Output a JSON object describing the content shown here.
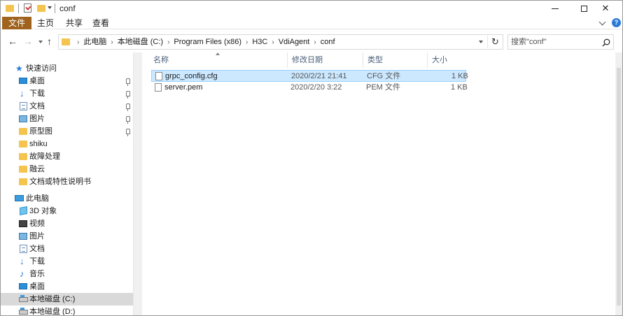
{
  "window": {
    "title": "conf",
    "controls": {
      "minimize": "",
      "maximize": "",
      "close": "✕"
    }
  },
  "ribbon": {
    "tabs": [
      "文件",
      "主页",
      "共享",
      "查看"
    ],
    "help": "?"
  },
  "nav": {
    "back": "←",
    "forward": "→",
    "up": "↑",
    "refresh": "↻",
    "breadcrumb": [
      "此电脑",
      "本地磁盘 (C:)",
      "Program Files (x86)",
      "H3C",
      "VdiAgent",
      "conf"
    ]
  },
  "search": {
    "placeholder": "搜索\"conf\""
  },
  "sidebar": {
    "items": [
      {
        "label": "快速访问",
        "icon": "star-icon",
        "indent": 0
      },
      {
        "label": "桌面",
        "icon": "desktop-icon",
        "indent": 1,
        "pinned": true
      },
      {
        "label": "下载",
        "icon": "download-icon",
        "indent": 1,
        "pinned": true
      },
      {
        "label": "文档",
        "icon": "document-icon",
        "indent": 1,
        "pinned": true
      },
      {
        "label": "图片",
        "icon": "pictures-icon",
        "indent": 1,
        "pinned": true
      },
      {
        "label": "原型图",
        "icon": "folder-icon",
        "indent": 1,
        "pinned": true
      },
      {
        "label": "shiku",
        "icon": "folder-icon",
        "indent": 1
      },
      {
        "label": "故障处理",
        "icon": "folder-icon",
        "indent": 1
      },
      {
        "label": "融云",
        "icon": "folder-icon",
        "indent": 1
      },
      {
        "label": "文档或特性说明书",
        "icon": "folder-icon",
        "indent": 1
      },
      {
        "label": "此电脑",
        "icon": "computer-icon",
        "indent": 0
      },
      {
        "label": "3D 对象",
        "icon": "3d-objects-icon",
        "indent": 1
      },
      {
        "label": "视频",
        "icon": "video-icon",
        "indent": 1
      },
      {
        "label": "图片",
        "icon": "pictures-icon",
        "indent": 1
      },
      {
        "label": "文档",
        "icon": "document-icon",
        "indent": 1
      },
      {
        "label": "下载",
        "icon": "download-icon",
        "indent": 1
      },
      {
        "label": "音乐",
        "icon": "music-icon",
        "indent": 1
      },
      {
        "label": "桌面",
        "icon": "desktop-icon",
        "indent": 1
      },
      {
        "label": "本地磁盘 (C:)",
        "icon": "drive-icon",
        "indent": 1,
        "selected": true
      },
      {
        "label": "本地磁盘 (D:)",
        "icon": "drive-icon",
        "indent": 1
      }
    ]
  },
  "columns": {
    "name": "名称",
    "date": "修改日期",
    "type": "类型",
    "size": "大小"
  },
  "files": [
    {
      "name": "grpc_config.cfg",
      "date": "2020/2/21 21:41",
      "type": "CFG 文件",
      "size": "1 KB",
      "selected": true
    },
    {
      "name": "server.pem",
      "date": "2020/2/20 3:22",
      "type": "PEM 文件",
      "size": "1 KB"
    }
  ],
  "colors": {
    "accent_file_tab": "#a0631e",
    "selection": "#cce8ff",
    "folder": "#f4c44e"
  }
}
